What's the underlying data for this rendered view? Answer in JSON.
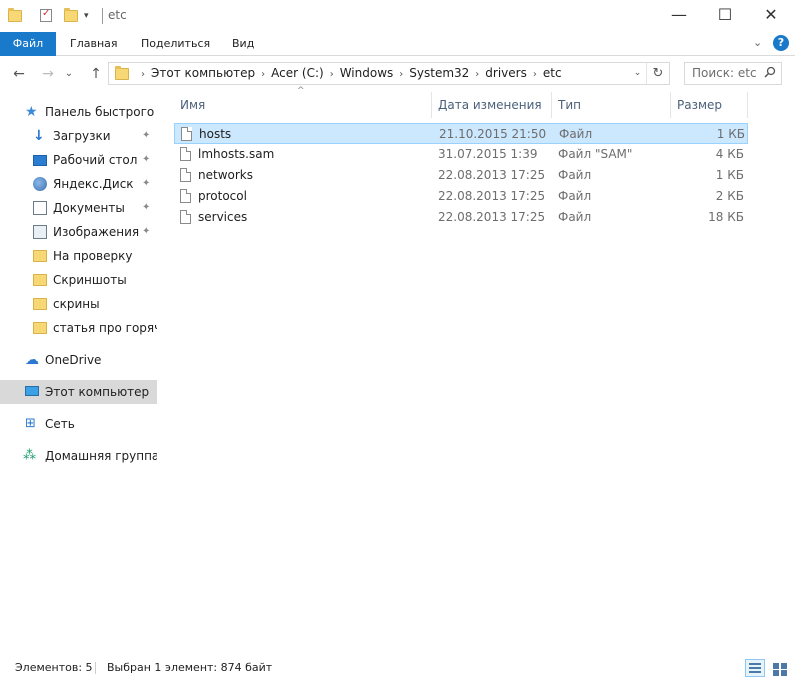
{
  "window": {
    "title": "etc",
    "minimize_glyph": "—",
    "maximize_glyph": "☐",
    "close_glyph": "✕"
  },
  "ribbon": {
    "tabs": [
      "Файл",
      "Главная",
      "Поделиться",
      "Вид"
    ],
    "expand_glyph": "⌄",
    "help_glyph": "?"
  },
  "nav": {
    "back_glyph": "←",
    "forward_glyph": "→",
    "recent_glyph": "⌄",
    "up_glyph": "↑",
    "breadcrumbs": [
      "Этот компьютер",
      "Acer (C:)",
      "Windows",
      "System32",
      "drivers",
      "etc"
    ],
    "crumb_sep": "›",
    "dropdown_glyph": "⌄",
    "refresh_glyph": "↻",
    "search_placeholder": "Поиск: etc"
  },
  "sidebar": {
    "quick_access": "Панель быстрого доступа",
    "items": [
      {
        "label": "Загрузки",
        "icon": "downloads-icon",
        "pinned": true
      },
      {
        "label": "Рабочий стол",
        "icon": "desktop-icon",
        "pinned": true
      },
      {
        "label": "Яндекс.Диск",
        "icon": "yandex-disk-icon",
        "pinned": true
      },
      {
        "label": "Документы",
        "icon": "documents-icon",
        "pinned": true
      },
      {
        "label": "Изображения",
        "icon": "pictures-icon",
        "pinned": true
      },
      {
        "label": "На проверку",
        "icon": "folder-icon",
        "pinned": false
      },
      {
        "label": "Скриншоты",
        "icon": "folder-icon",
        "pinned": false
      },
      {
        "label": "скрины",
        "icon": "folder-icon",
        "pinned": false
      },
      {
        "label": "статья про горячие",
        "icon": "folder-icon",
        "pinned": false
      }
    ],
    "onedrive": "OneDrive",
    "this_pc": "Этот компьютер",
    "network": "Сеть",
    "homegroup": "Домашняя группа",
    "pin_glyph": "📌"
  },
  "columns": {
    "name": "Имя",
    "date": "Дата изменения",
    "type": "Тип",
    "size": "Размер",
    "sort_glyph": "^"
  },
  "files": [
    {
      "name": "hosts",
      "date": "21.10.2015 21:50",
      "type": "Файл",
      "size": "1 КБ",
      "selected": true
    },
    {
      "name": "lmhosts.sam",
      "date": "31.07.2015 1:39",
      "type": "Файл \"SAM\"",
      "size": "4 КБ",
      "selected": false
    },
    {
      "name": "networks",
      "date": "22.08.2013 17:25",
      "type": "Файл",
      "size": "1 КБ",
      "selected": false
    },
    {
      "name": "protocol",
      "date": "22.08.2013 17:25",
      "type": "Файл",
      "size": "2 КБ",
      "selected": false
    },
    {
      "name": "services",
      "date": "22.08.2013 17:25",
      "type": "Файл",
      "size": "18 КБ",
      "selected": false
    }
  ],
  "status": {
    "count": "Элементов: 5",
    "selection": "Выбран 1 элемент: 874 байт"
  }
}
